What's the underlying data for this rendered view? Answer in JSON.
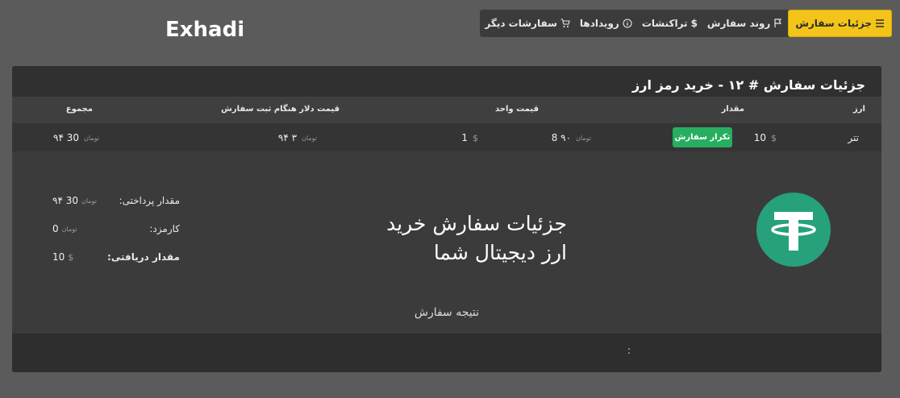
{
  "brand": "Exhadi",
  "tabs": [
    {
      "label": "جزئیات سفارش",
      "icon": "list-icon",
      "active": true
    },
    {
      "label": "روند سفارش",
      "icon": "flag-icon"
    },
    {
      "label": "تراکنشات",
      "icon": "dollar-icon"
    },
    {
      "label": "رویدادها",
      "icon": "info-circle-icon"
    },
    {
      "label": "سفارشات دیگر",
      "icon": "cart-icon"
    }
  ],
  "card": {
    "title": "جزئیات سفارش # ۱۲ - خرید رمز ارز"
  },
  "table": {
    "headers": {
      "currency": "ارز",
      "amount": "مقدار",
      "unit_price": "قیمت واحد",
      "usd_price": "قیمت دلار هنگام ثبت سفارش",
      "total": "مجموع"
    },
    "row": {
      "currency": "تتر",
      "amount": "10",
      "amount_unit": "$",
      "repeat_button": "تکرار سفارش",
      "unit_price_toman": "8 ۹۰",
      "unit_price_toman_unit": "تومان",
      "unit_price_usd": "1",
      "unit_price_usd_unit": "$",
      "usd_price": "۹۴ ۳",
      "usd_price_unit": "تومان",
      "total": "۹۴ 30",
      "total_unit": "تومان"
    }
  },
  "promo": {
    "line1": "جزئیات سفارش خرید",
    "line2": "ارز دیجیتال شما"
  },
  "summary": {
    "paid_label": "مقدار پرداختی:",
    "paid_value": "۹۴ 30",
    "paid_unit": "تومان",
    "fee_label": "کارمزد:",
    "fee_value": "0",
    "fee_unit": "تومان",
    "received_label": "مقدار دریافتی:",
    "received_value": "10",
    "received_unit": "$"
  },
  "result_label": "نتیجه سفارش",
  "footer_text": ":",
  "colors": {
    "accent": "#f3c41a",
    "success": "#27ae60",
    "tether": "#26a17b"
  }
}
